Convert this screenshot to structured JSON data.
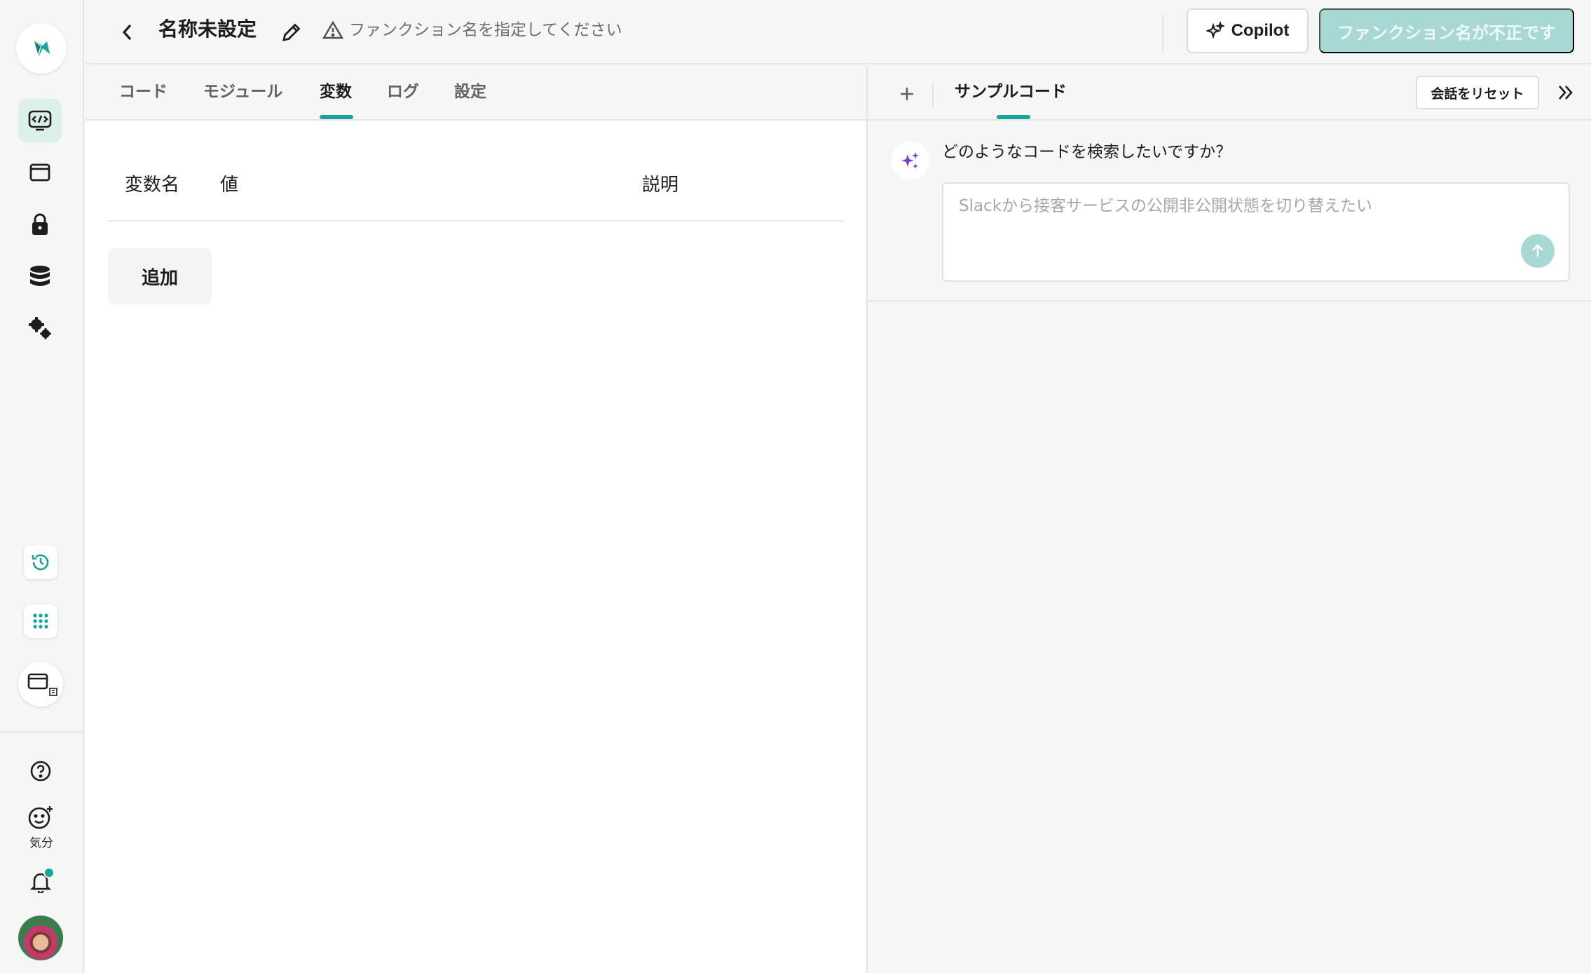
{
  "sidebar": {
    "icons": [
      "logo-icon",
      "function-editor-icon",
      "window-icon",
      "lock-icon",
      "database-icon",
      "gears-icon",
      "history-icon",
      "apps-grid-icon",
      "window-preview-icon",
      "help-icon",
      "mood-icon",
      "bell-icon",
      "avatar"
    ],
    "mood_label": "気分"
  },
  "header": {
    "title": "名称未設定",
    "warning": "ファンクション名を指定してください",
    "copilot_label": "Copilot",
    "submit_label": "ファンクション名が不正です"
  },
  "left_tabs": {
    "items": [
      "コード",
      "モジュール",
      "変数",
      "ログ",
      "設定"
    ],
    "active": "変数"
  },
  "variables": {
    "col_name": "変数名",
    "col_value": "値",
    "col_desc": "説明",
    "add_label": "追加"
  },
  "right_panel": {
    "tab_label": "サンプルコード",
    "reset_label": "会話をリセット",
    "question": "どのようなコードを検索したいですか？",
    "input_placeholder": "Slackから接客サービスの公開非公開状態を切り替えたい",
    "input_value": ""
  },
  "colors": {
    "accent": "#1aa39a",
    "accent_light": "#a8d8d4",
    "ai_purple": "#7b3fd0"
  }
}
